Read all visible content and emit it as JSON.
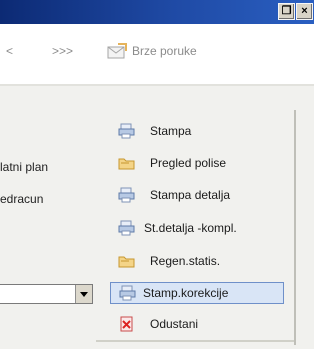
{
  "window": {
    "restore_label": "❒",
    "close_label": "×"
  },
  "toolbar": {
    "nav_left": "<",
    "nav_right": ">>>",
    "messages_label": "Brze poruke"
  },
  "left_labels": [
    "latni plan",
    "edracun"
  ],
  "menu": {
    "items": [
      {
        "label": "Stampa",
        "icon": "printer-icon"
      },
      {
        "label": "Pregled polise",
        "icon": "folder-icon"
      },
      {
        "label": "Stampa detalja",
        "icon": "printer-icon"
      },
      {
        "label": "St.detalja -kompl.",
        "icon": "printer-icon"
      },
      {
        "label": "Regen.statis.",
        "icon": "folder-icon"
      },
      {
        "label": "Stamp.korekcije",
        "icon": "printer-icon",
        "selected": true
      },
      {
        "label": "Odustani",
        "icon": "cancel-icon"
      }
    ]
  },
  "colors": {
    "titlebar": "#1f4aa5",
    "selection_bg": "#d9e5f6",
    "selection_border": "#6f90c9",
    "panel_bg": "#f1f1ee"
  }
}
